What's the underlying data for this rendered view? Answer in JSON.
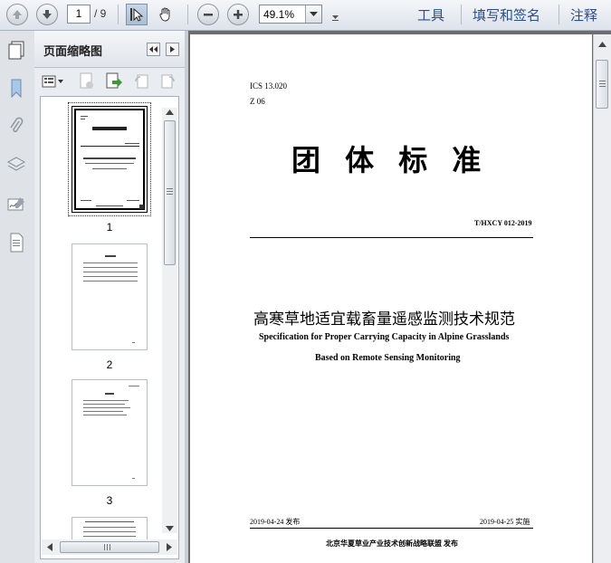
{
  "toolbar": {
    "page_current": "1",
    "page_total": "/ 9",
    "zoom": "49.1%",
    "links": [
      "工具",
      "填写和签名",
      "注释"
    ]
  },
  "panel": {
    "title": "页面缩略图",
    "thumbnails": [
      {
        "page_label": "1"
      },
      {
        "page_label": "2"
      },
      {
        "page_label": "3"
      }
    ]
  },
  "document": {
    "ics": "ICS 13.020",
    "category": "Z 06",
    "main_title": "团 体 标 准",
    "standard_number": "T/HXCY 012-2019",
    "title_cn": "高寒草地适宜载畜量遥感监测技术规范",
    "title_en_line1": "Specification for Proper Carrying Capacity in Alpine Grasslands",
    "title_en_line2": "Based on Remote Sensing Monitoring",
    "publish_date": "2019-04-24 发布",
    "implement_date": "2019-04-25 实施",
    "publisher": "北京华夏草业产业技术创新战略联盟 发布"
  },
  "icons": [
    "up-arrow-icon",
    "down-arrow-icon",
    "select-cursor-icon",
    "hand-icon",
    "zoom-out-icon",
    "zoom-in-icon",
    "pages-icon",
    "bookmark-icon",
    "attachment-icon",
    "layers-icon",
    "signature-icon",
    "document-icon"
  ]
}
